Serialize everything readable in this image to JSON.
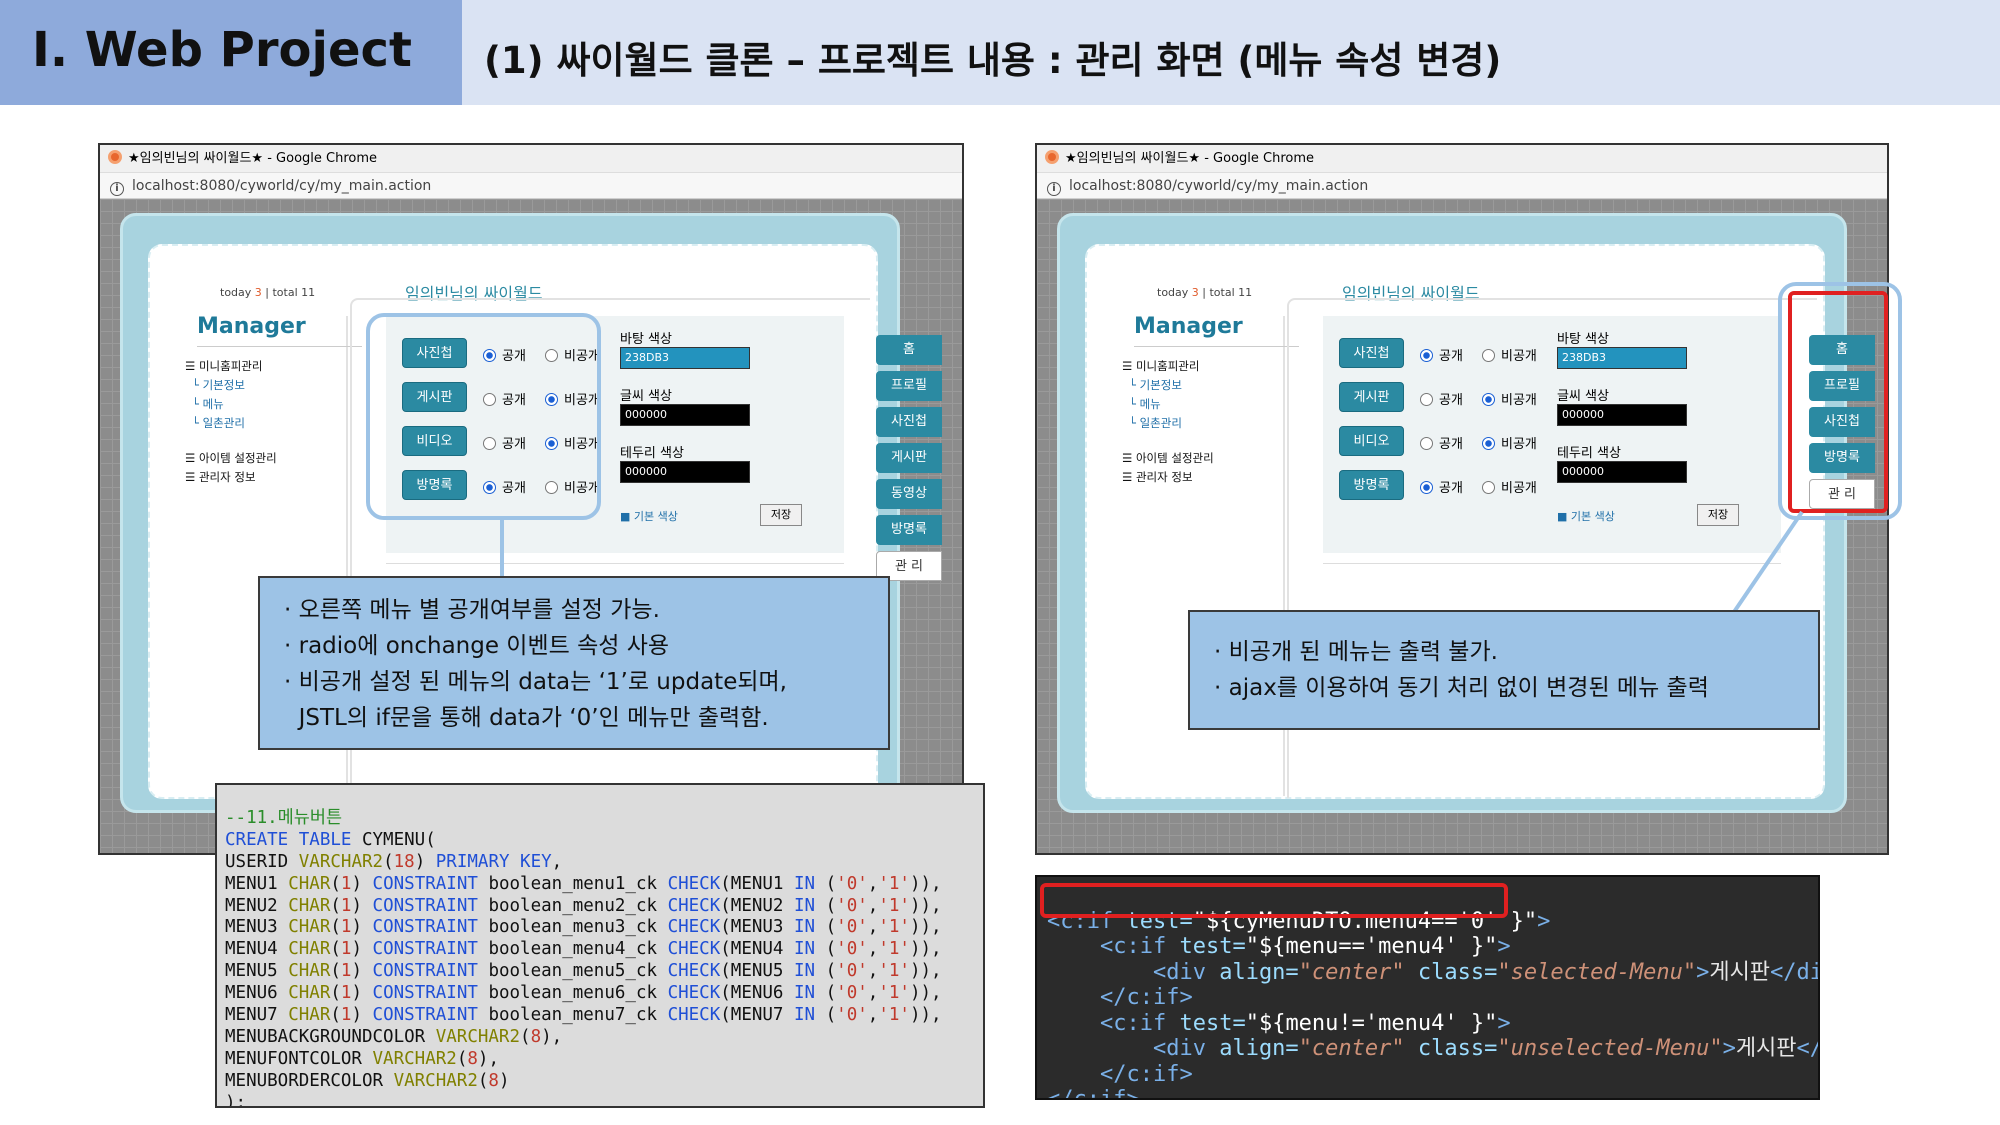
{
  "header": {
    "title": "Ⅰ. Web Project",
    "subtitle": "(1) 싸이월드 클론 – 프로젝트 내용 : 관리 화면 (메뉴 속성 변경)"
  },
  "browser": {
    "window_title": "★임의빈님의 싸이월드★ - Google Chrome",
    "url": "localhost:8080/cyworld/cy/my_main.action"
  },
  "app": {
    "today_label": "today",
    "today_count": "3",
    "total_label": "| total 11",
    "site_title": "임의빈님의 싸이월드",
    "manager_title": "Manager",
    "nav": [
      "☰ 미니홈피관리",
      "└ 기본정보",
      "└ 메뉴",
      "└ 일촌관리",
      "☰ 아이템 설정관리",
      "☰ 관리자 정보"
    ],
    "menu_rows": [
      {
        "label": "사진첩",
        "public": "공개",
        "private": "비공개",
        "selected": "public"
      },
      {
        "label": "게시판",
        "public": "공개",
        "private": "비공개",
        "selected": "private"
      },
      {
        "label": "비디오",
        "public": "공개",
        "private": "비공개",
        "selected": "private"
      },
      {
        "label": "방명록",
        "public": "공개",
        "private": "비공개",
        "selected": "public"
      }
    ],
    "colors": [
      {
        "label": "바탕 색상",
        "value": "238DB3",
        "swatch": "#2393be"
      },
      {
        "label": "글씨 색상",
        "value": "000000",
        "swatch": "#000000"
      },
      {
        "label": "테두리 색상",
        "value": "000000",
        "swatch": "#000000"
      }
    ],
    "basic_color": "■ 기본 색상",
    "save_label": "저장",
    "right_menu_left": [
      "홈",
      "프로필",
      "사진첩",
      "게시판",
      "동영상",
      "방명록",
      "관 리"
    ],
    "right_menu_right": [
      "홈",
      "프로필",
      "사진첩",
      "방명록",
      "관 리"
    ]
  },
  "callout_left": [
    "· 오른쪽 메뉴 별 공개여부를 설정 가능.",
    "· radio에 onchange 이벤트 속성 사용",
    "· 비공개 설정 된 메뉴의 data는 ‘1’로 update되며,",
    "  JSTL의 if문을 통해 data가 ‘0’인 메뉴만 출력함."
  ],
  "callout_right": [
    "· 비공개 된 메뉴는 출력 불가.",
    "· ajax를 이용하여 동기 처리 없이 변경된 메뉴 출력"
  ],
  "sql_lines": [
    "--11.메뉴버튼",
    "CREATE TABLE CYMENU(",
    "USERID VARCHAR2(18) PRIMARY KEY,",
    "MENU1 CHAR(1) CONSTRAINT boolean_menu1_ck CHECK(MENU1 IN ('0','1')),",
    "MENU2 CHAR(1) CONSTRAINT boolean_menu2_ck CHECK(MENU2 IN ('0','1')),",
    "MENU3 CHAR(1) CONSTRAINT boolean_menu3_ck CHECK(MENU3 IN ('0','1')),",
    "MENU4 CHAR(1) CONSTRAINT boolean_menu4_ck CHECK(MENU4 IN ('0','1')),",
    "MENU5 CHAR(1) CONSTRAINT boolean_menu5_ck CHECK(MENU5 IN ('0','1')),",
    "MENU6 CHAR(1) CONSTRAINT boolean_menu6_ck CHECK(MENU6 IN ('0','1')),",
    "MENU7 CHAR(1) CONSTRAINT boolean_menu7_ck CHECK(MENU7 IN ('0','1')),",
    "MENUBACKGROUNDCOLOR VARCHAR2(8),",
    "MENUFONTCOLOR VARCHAR2(8),",
    "MENUBORDERCOLOR VARCHAR2(8)",
    ");"
  ],
  "jstl_lines": [
    "<c:if test=\"${cyMenuDTO.menu4=='0' }\">",
    "    <c:if test=\"${menu=='menu4' }\">",
    "        <div align=\"center\" class=\"selected-Menu\">게시판</div>",
    "    </c:if>",
    "    <c:if test=\"${menu!='menu4' }\">",
    "        <div align=\"center\" class=\"unselected-Menu\">게시판</div>",
    "    </c:if>",
    "</c:if>"
  ]
}
